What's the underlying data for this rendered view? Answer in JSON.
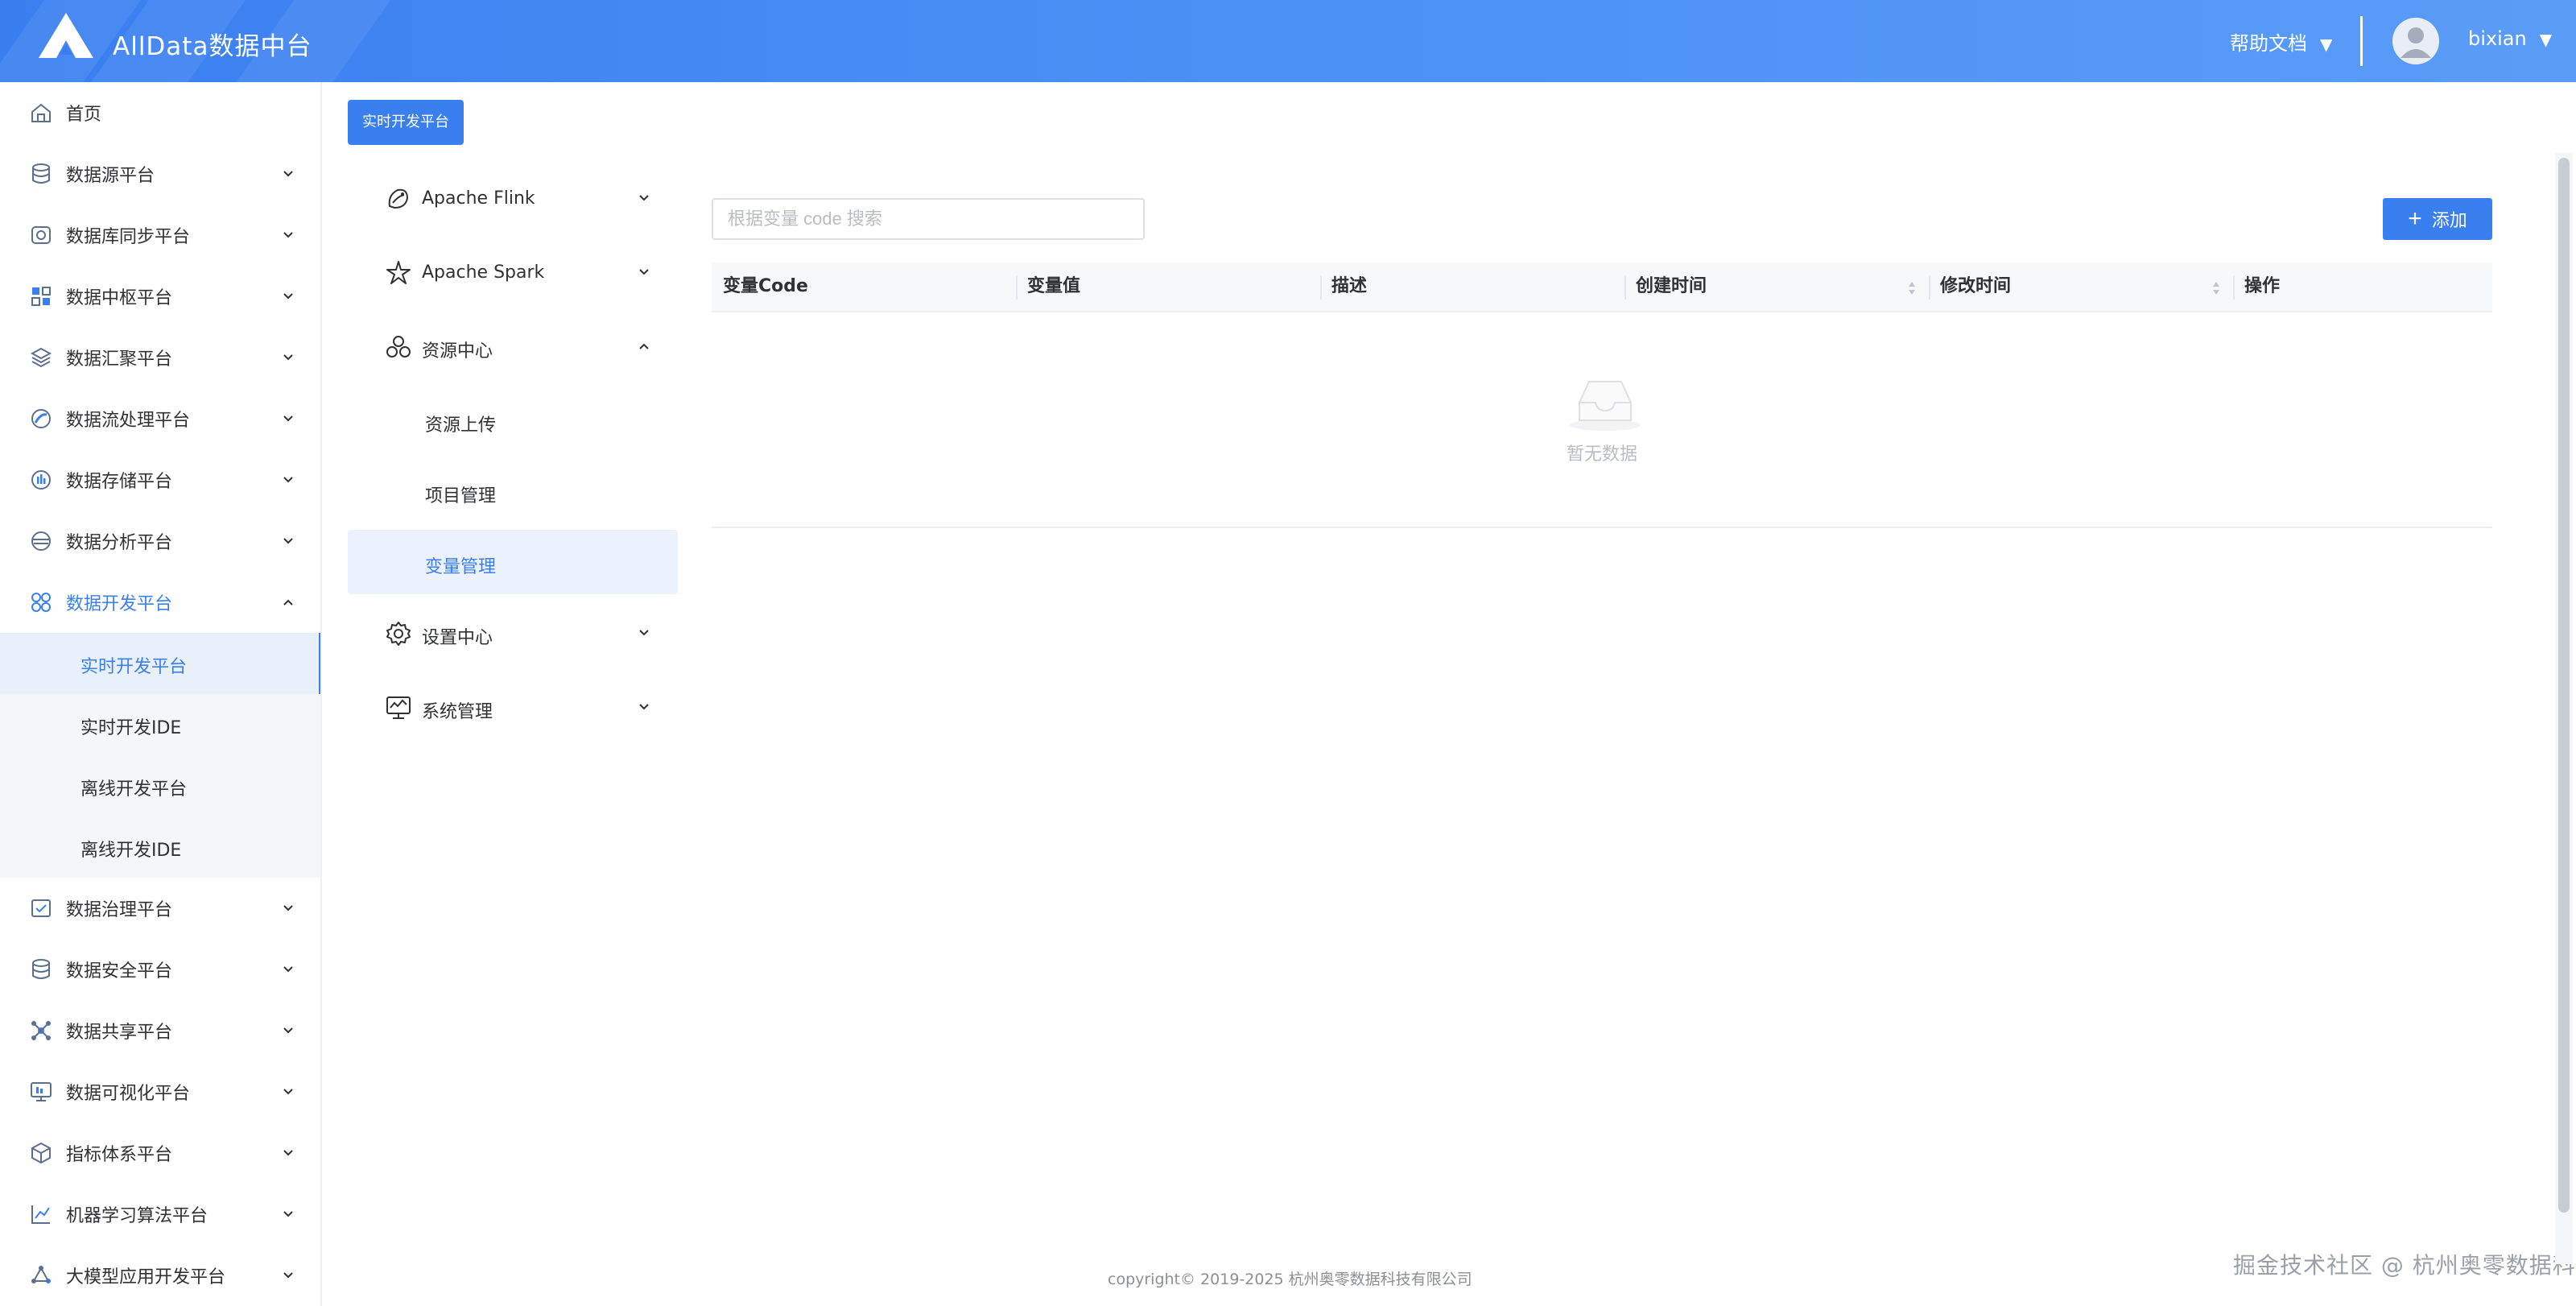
{
  "header": {
    "app_title": "AllData数据中台",
    "help_label": "帮助文档",
    "user_name": "bixian",
    "caret": "▼"
  },
  "sidebar": {
    "items": [
      {
        "label": "首页",
        "icon": "home-icon",
        "expandable": false
      },
      {
        "label": "数据源平台",
        "icon": "database-icon",
        "expandable": true
      },
      {
        "label": "数据库同步平台",
        "icon": "sync-icon",
        "expandable": true
      },
      {
        "label": "数据中枢平台",
        "icon": "hub-icon",
        "expandable": true
      },
      {
        "label": "数据汇聚平台",
        "icon": "layers-icon",
        "expandable": true
      },
      {
        "label": "数据流处理平台",
        "icon": "stream-icon",
        "expandable": true
      },
      {
        "label": "数据存储平台",
        "icon": "storage-icon",
        "expandable": true
      },
      {
        "label": "数据分析平台",
        "icon": "analysis-icon",
        "expandable": true
      },
      {
        "label": "数据开发平台",
        "icon": "develop-icon",
        "expandable": true,
        "expanded": true,
        "active": true
      }
    ],
    "sub_items": [
      {
        "label": "实时开发平台",
        "selected": true
      },
      {
        "label": "实时开发IDE",
        "selected": false
      },
      {
        "label": "离线开发平台",
        "selected": false
      },
      {
        "label": "离线开发IDE",
        "selected": false
      }
    ],
    "items_after": [
      {
        "label": "数据治理平台",
        "icon": "governance-icon"
      },
      {
        "label": "数据安全平台",
        "icon": "security-icon"
      },
      {
        "label": "数据共享平台",
        "icon": "share-icon"
      },
      {
        "label": "数据可视化平台",
        "icon": "visualization-icon"
      },
      {
        "label": "指标体系平台",
        "icon": "metrics-icon"
      },
      {
        "label": "机器学习算法平台",
        "icon": "ml-icon"
      },
      {
        "label": "大模型应用开发平台",
        "icon": "llm-icon"
      }
    ]
  },
  "tab": {
    "label": "实时开发平台"
  },
  "menu": {
    "items": [
      {
        "label": "Apache Flink",
        "icon": "flink-icon"
      },
      {
        "label": "Apache Spark",
        "icon": "spark-icon"
      },
      {
        "label": "资源中心",
        "icon": "resource-icon",
        "expanded": true
      }
    ],
    "sub_items": [
      {
        "label": "资源上传",
        "selected": false
      },
      {
        "label": "项目管理",
        "selected": false
      },
      {
        "label": "变量管理",
        "selected": true
      }
    ],
    "items_after": [
      {
        "label": "设置中心",
        "icon": "settings-icon"
      },
      {
        "label": "系统管理",
        "icon": "system-monitor-icon"
      }
    ]
  },
  "search": {
    "placeholder": "根据变量 code 搜索",
    "value": ""
  },
  "toolbar": {
    "add_label": "添加"
  },
  "table": {
    "columns": [
      "变量Code",
      "变量值",
      "描述",
      "创建时间",
      "修改时间",
      "操作"
    ],
    "sortable": [
      false,
      false,
      false,
      true,
      true,
      false
    ],
    "rows": [],
    "empty_text": "暂无数据"
  },
  "footer": {
    "copyright": "copyright© 2019-2025 杭州奥零数据科技有限公司",
    "watermark": "掘金技术社区 @ 杭州奥零数据科技"
  },
  "colors": {
    "primary": "#3a7ff0",
    "header_gradient_start": "#3a7ff0",
    "header_gradient_end": "#5a9cf7",
    "text": "#303133",
    "muted": "#b8bcc4"
  }
}
